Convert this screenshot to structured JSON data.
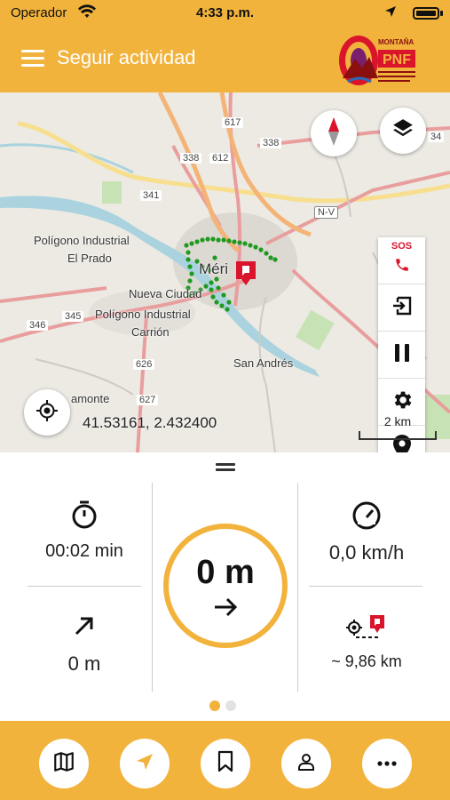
{
  "status_bar": {
    "carrier": "Operador",
    "time": "4:33 p.m.",
    "wifi_icon": "wifi-icon",
    "location_icon": "location-arrow-icon",
    "battery_icon": "battery-icon"
  },
  "header": {
    "title": "Seguir actividad",
    "menu_icon": "hamburger-menu-icon",
    "logo_text": "MONTAÑA"
  },
  "map": {
    "place_labels": {
      "poligono_el_prado_1": "Polígono Industrial",
      "poligono_el_prado_2": "El Prado",
      "merida": "Méri",
      "nueva_ciudad": "Nueva Ciudad",
      "poligono_carrion_1": "Polígono Industrial",
      "poligono_carrion_2": "Carrión",
      "san_andres": "San Andrés",
      "calamonte": "amonte"
    },
    "road_labels": {
      "r617": "617",
      "r338a": "338",
      "r338b": "338",
      "r612": "612",
      "r341": "341",
      "r346": "346",
      "r345": "345",
      "r626": "626",
      "r627": "627",
      "r34": "34",
      "nv": "N-V"
    },
    "coordinates": "41.53161, 2.432400",
    "scale_label": "2 km",
    "controls": {
      "compass": "compass-icon",
      "layers": "layers-icon",
      "sos_label": "SOS",
      "sos_icon": "phone-icon",
      "exit": "exit-icon",
      "pause": "pause-icon",
      "settings": "gear-icon",
      "waypoint": "map-pin-icon",
      "locate": "gps-locate-icon"
    }
  },
  "stats": {
    "duration": "00:02 min",
    "speed": "0,0 km/h",
    "distance_center": "0 m",
    "elevation_gain": "0 m",
    "distance_to_target": "~ 9,86 km",
    "icons": {
      "duration": "stopwatch-icon",
      "speed": "speedometer-icon",
      "elevation": "arrow-up-right-icon",
      "target": "distance-to-pin-icon",
      "direction": "arrow-right-icon"
    }
  },
  "page_indicator": {
    "total": 2,
    "active": 1
  },
  "bottom_nav": {
    "items": [
      {
        "name": "map",
        "icon": "map-icon"
      },
      {
        "name": "navigate",
        "icon": "navigation-arrow-icon"
      },
      {
        "name": "bookmark",
        "icon": "bookmark-icon"
      },
      {
        "name": "profile",
        "icon": "user-icon"
      },
      {
        "name": "more",
        "icon": "more-dots-icon"
      }
    ]
  },
  "colors": {
    "accent": "#F2B33D",
    "track": "#1f9a1f",
    "pin": "#d9142b",
    "water": "#aad3df"
  }
}
